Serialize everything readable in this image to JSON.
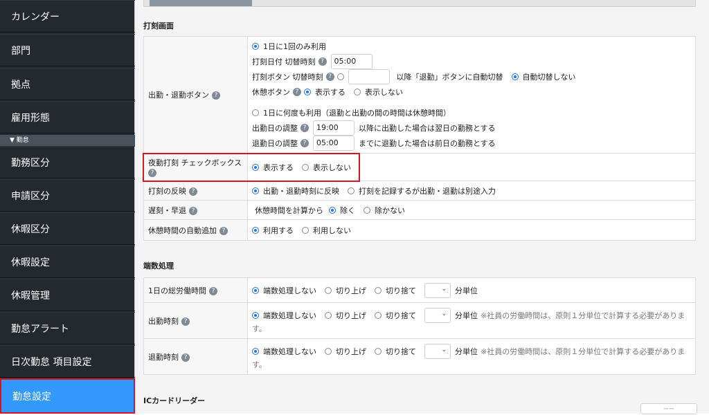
{
  "sidebar": {
    "items": [
      "カレンダー",
      "部門",
      "拠点",
      "雇用形態"
    ],
    "section": "▼ 勤怠",
    "items2": [
      "勤務区分",
      "申請区分",
      "休暇区分",
      "休暇設定",
      "休暇管理",
      "勤怠アラート",
      "日次勤怠 項目設定",
      "勤怠設定"
    ]
  },
  "help": "?",
  "punch": {
    "title": "打刻画面",
    "button_label": "出勤・退勤ボタン",
    "once": "1日に1回のみ利用",
    "date_switch_label": "打刻日付 切替時刻",
    "date_switch_value": "05:00",
    "btn_switch_label": "打刻ボタン 切替時刻",
    "btn_switch_after": "以降「退勤」ボタンに自動切替",
    "no_auto": "自動切替しない",
    "break_label": "休憩ボタン",
    "show": "表示する",
    "hide": "表示しない",
    "many": "1日に何度も利用（退勤と出勤の間の時間は休憩時間）",
    "in_adj_label": "出勤日の調整",
    "in_adj_value": "19:00",
    "in_adj_note": "以降に出勤した場合は翌日の勤務とする",
    "out_adj_label": "退勤日の調整",
    "out_adj_value": "05:00",
    "out_adj_note": "までに退勤した場合は前日の勤務とする",
    "night_label": "夜勤打刻 チェックボックス",
    "reflect_label": "打刻の反映",
    "reflect_a": "出勤・退勤時刻に反映",
    "reflect_b": "打刻を記録するが出勤・退勤は別途入力",
    "late_label": "遅刻・早退",
    "late_prefix": "休憩時間を計算から",
    "exclude": "除く",
    "not_exclude": "除かない",
    "auto_break_label": "休憩時間の自動追加",
    "use": "利用する",
    "not_use": "利用しない"
  },
  "rounding": {
    "title": "端数処理",
    "total_label": "1日の総労働時間",
    "clock_in_label": "出勤時刻",
    "clock_out_label": "退勤時刻",
    "none": "端数処理しない",
    "up": "切り上げ",
    "down": "切り捨て",
    "unit": "分単位",
    "note": "※社員の労働時間は、原則１分単位で計算する必要がありま",
    "note_tail": "す。"
  },
  "ic": {
    "title": "ICカードリーダー",
    "button": "ーー"
  }
}
